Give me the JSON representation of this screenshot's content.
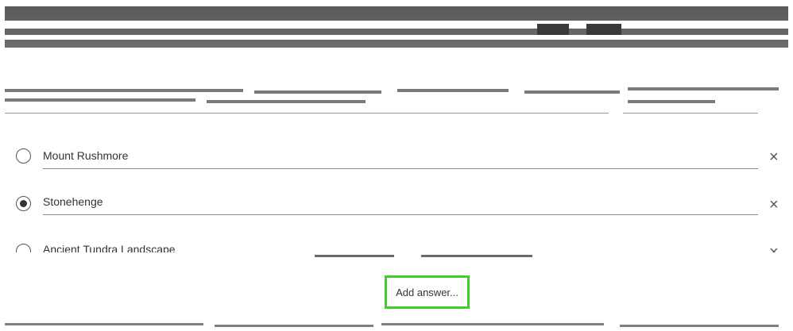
{
  "answers": [
    {
      "label": "Mount Rushmore",
      "selected": false,
      "remove_glyph": "×"
    },
    {
      "label": "Stonehenge",
      "selected": true,
      "remove_glyph": "×"
    },
    {
      "label": "Ancient Tundra Landscape",
      "selected": false,
      "remove_glyph": "×"
    }
  ],
  "add_answer": {
    "label": "Add answer..."
  },
  "colors": {
    "add_border": "#3fcf2c",
    "text": "#333333"
  }
}
